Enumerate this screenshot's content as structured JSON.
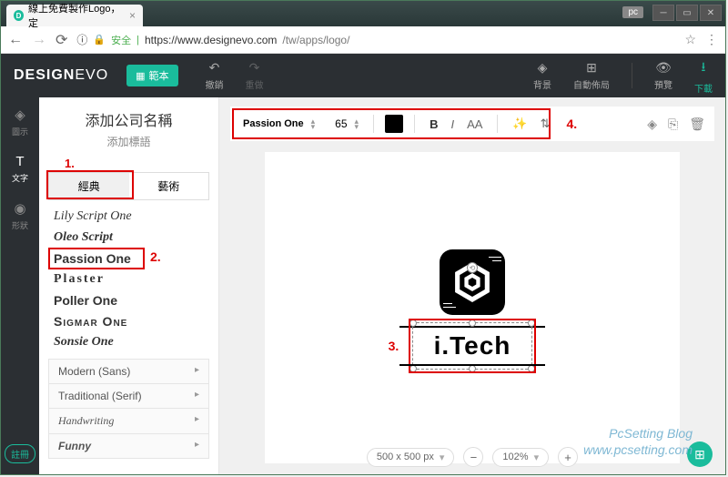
{
  "browser": {
    "tab_title": "線上免費製作Logo，定",
    "pc_label": "pc",
    "secure_label": "安全",
    "url_host": "https://www.designevo.com",
    "url_path": "/tw/apps/logo/"
  },
  "header": {
    "logo_a": "DESIGN",
    "logo_b": "EVO",
    "template": "範本",
    "undo": "撤銷",
    "redo": "重做",
    "background": "背景",
    "autolayout": "自動佈局",
    "preview": "預覽",
    "download": "下載"
  },
  "left_tools": {
    "icon": "圖示",
    "text": "文字",
    "shape": "形狀",
    "register": "註冊"
  },
  "side": {
    "add_company": "添加公司名稱",
    "add_slogan": "添加標語",
    "tab_classic": "經典",
    "tab_art": "藝術",
    "fonts": {
      "lily": "Lily Script One",
      "oleo": "Oleo Script",
      "passion": "Passion One",
      "plaster": "Plaster",
      "poller": "Poller One",
      "sigmar": "Sigmar One",
      "sonsie": "Sonsie One"
    },
    "cats": {
      "modern": "Modern (Sans)",
      "trad": "Traditional (Serif)",
      "hand": "Handwriting",
      "funny": "Funny"
    }
  },
  "toolbar": {
    "font": "Passion One",
    "size": "65",
    "bold": "B",
    "italic": "I",
    "caps": "AA"
  },
  "canvas": {
    "text": "i.Tech",
    "size_label": "500 x 500 px",
    "zoom": "102%"
  },
  "annotations": {
    "a1": "1.",
    "a2": "2.",
    "a3": "3.",
    "a4": "4."
  },
  "watermark": {
    "l1": "PcSetting Blog",
    "l2": "www.pcsetting.com"
  }
}
